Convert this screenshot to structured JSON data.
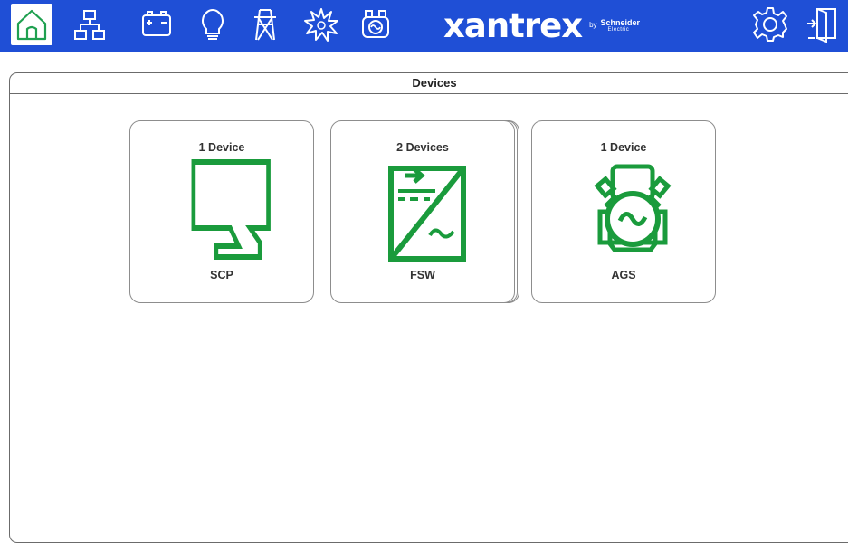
{
  "header": {
    "brand": "xantrex",
    "brand_by": "by",
    "brand_partner": "Schneider",
    "brand_partner_sub": "Electric",
    "nav_icons": [
      "home-icon",
      "network-icon",
      "battery-icon",
      "lightbulb-icon",
      "power-tower-icon",
      "burst-icon",
      "generator-icon"
    ],
    "right_icons": [
      "settings-icon",
      "logout-door-icon"
    ],
    "colors": {
      "bar": "#1f4fd6",
      "icon": "#ffffff",
      "active_icon": "#1fa050"
    }
  },
  "panel": {
    "title": "Devices"
  },
  "devices": [
    {
      "count": "1 Device",
      "label": "SCP",
      "icon": "scp-panel-icon"
    },
    {
      "count": "2 Devices",
      "label": "FSW",
      "icon": "fsw-inverter-icon"
    },
    {
      "count": "1 Device",
      "label": "AGS",
      "icon": "ags-generator-icon"
    }
  ],
  "accent_green": "#1a9b3c"
}
